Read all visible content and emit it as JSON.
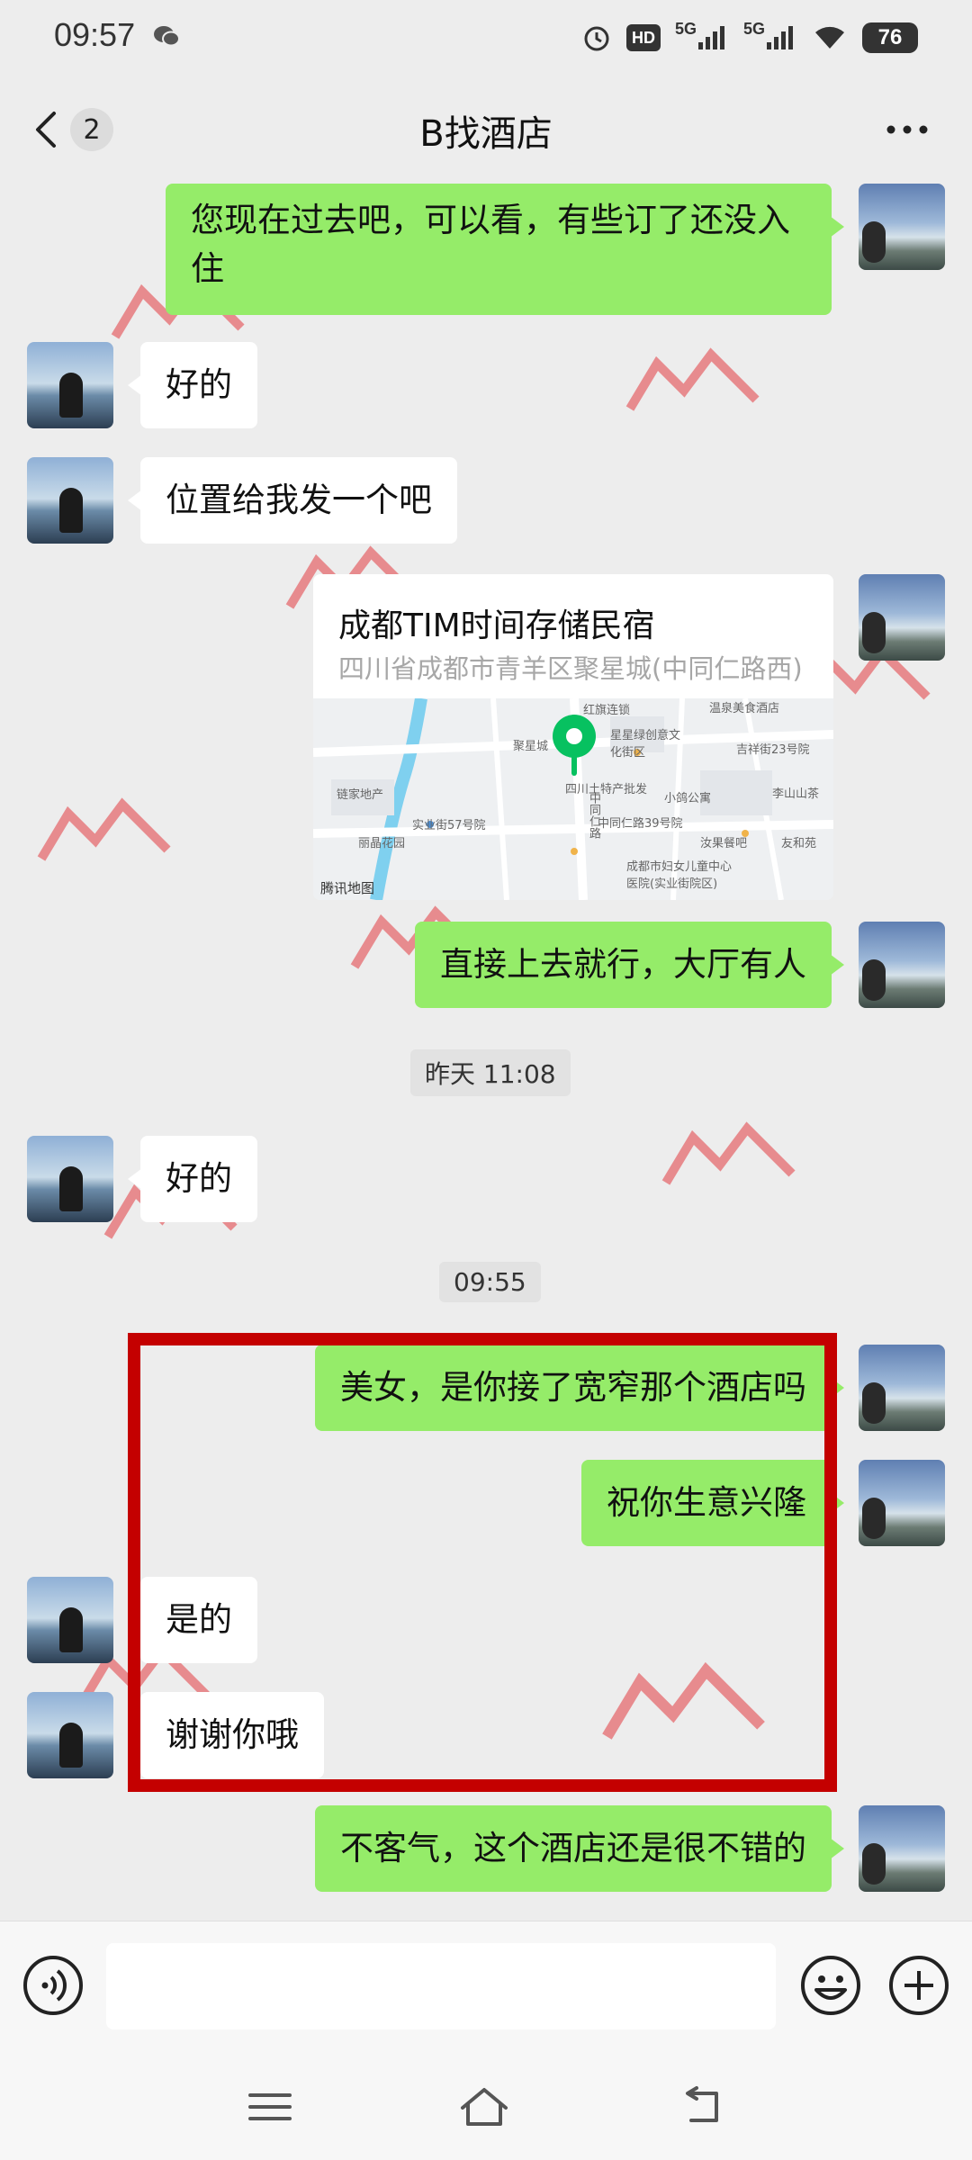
{
  "status_bar": {
    "time": "09:57",
    "hd_label": "HD",
    "signal1": "5G",
    "signal2": "5G",
    "battery": "76"
  },
  "nav": {
    "unread_count": "2",
    "title": "B找酒店"
  },
  "messages": [
    {
      "from": "me",
      "text": "您现在过去吧，可以看，有些订了还没入住"
    },
    {
      "from": "her",
      "text": "好的"
    },
    {
      "from": "her",
      "text": "位置给我发一个吧"
    },
    {
      "from": "me",
      "type": "location",
      "title": "成都TIM时间存储民宿",
      "address": "四川省成都市青羊区聚星城(中同仁路西)",
      "map_provider": "腾讯地图"
    },
    {
      "from": "me",
      "text": "直接上去就行，大厅有人"
    },
    {
      "type": "time",
      "text": "昨天 11:08"
    },
    {
      "from": "her",
      "text": "好的"
    },
    {
      "type": "time",
      "text": "09:55"
    },
    {
      "from": "me",
      "text": "美女，是你接了宽窄那个酒店吗"
    },
    {
      "from": "me",
      "text": "祝你生意兴隆"
    },
    {
      "from": "her",
      "text": "是的"
    },
    {
      "from": "her",
      "text": "谢谢你哦"
    },
    {
      "from": "me",
      "text": "不客气，这个酒店还是很不错的"
    }
  ],
  "map_labels": [
    "红旗连锁",
    "温泉美食酒店",
    "聚星城",
    "星星绿创意文化街区",
    "吉祥街23号院",
    "四川土特产批发",
    "小鸽公寓",
    "李山山茶",
    "链家地产",
    "实业街57号院",
    "中同仁路39号院",
    "汝果餐吧",
    "友和苑",
    "丽晶花园",
    "成都市妇女儿童中心医院(实业街院区)",
    "中同仁路"
  ],
  "colors": {
    "me_bubble": "#95ec69",
    "her_bubble": "#ffffff",
    "highlight_box": "#c40000",
    "background": "#ededed"
  }
}
